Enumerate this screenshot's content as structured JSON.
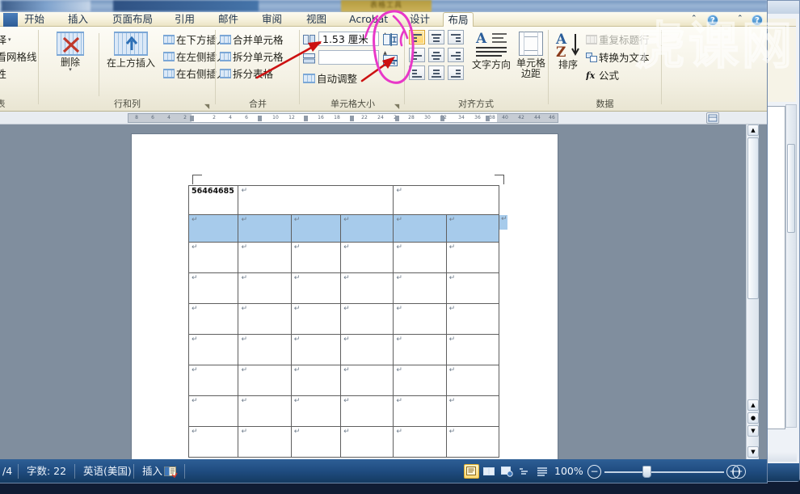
{
  "window": {
    "contextual_tab_header": "表格工具",
    "watermark": "虎课网"
  },
  "tabs": [
    {
      "label": "开始",
      "active": false
    },
    {
      "label": "插入",
      "active": false
    },
    {
      "label": "页面布局",
      "active": false
    },
    {
      "label": "引用",
      "active": false
    },
    {
      "label": "邮件",
      "active": false
    },
    {
      "label": "审阅",
      "active": false
    },
    {
      "label": "视图",
      "active": false
    },
    {
      "label": "Acrobat",
      "active": false
    },
    {
      "label": "设计",
      "active": false
    },
    {
      "label": "布局",
      "active": true
    }
  ],
  "ribbon": {
    "groups": [
      {
        "name": "表",
        "title": "表",
        "items": [
          {
            "label": "选择",
            "icon": "select-table-icon"
          },
          {
            "label": "查看网格线",
            "icon": "view-gridlines-icon"
          },
          {
            "label": "属性",
            "icon": "table-properties-icon"
          }
        ]
      },
      {
        "name": "行和列",
        "title": "行和列",
        "items": [
          {
            "label": "删除",
            "icon": "delete-table-icon"
          },
          {
            "label": "在上方插入",
            "icon": "insert-above-icon"
          },
          {
            "label": "在下方插入",
            "icon": "insert-below-icon"
          },
          {
            "label": "在左侧插入",
            "icon": "insert-left-icon"
          },
          {
            "label": "在右侧插入",
            "icon": "insert-right-icon"
          }
        ]
      },
      {
        "name": "合并",
        "title": "合并",
        "items": [
          {
            "label": "合并单元格",
            "icon": "merge-cells-icon"
          },
          {
            "label": "拆分单元格",
            "icon": "split-cells-icon"
          },
          {
            "label": "拆分表格",
            "icon": "split-table-icon"
          }
        ]
      },
      {
        "name": "单元格大小",
        "title": "单元格大小",
        "height_value": "1.53 厘米",
        "width_value": "",
        "items": [
          {
            "label": "自动调整",
            "icon": "autofit-icon"
          },
          {
            "label": "",
            "icon": "distribute-rows-icon"
          },
          {
            "label": "",
            "icon": "distribute-columns-icon"
          }
        ]
      },
      {
        "name": "对齐方式",
        "title": "对齐方式",
        "align_buttons": [
          "align-top-left",
          "align-top-center",
          "align-top-right",
          "align-middle-left",
          "align-middle-center",
          "align-middle-right",
          "align-bottom-left",
          "align-bottom-center",
          "align-bottom-right"
        ],
        "selected_align": "align-top-left",
        "items": [
          {
            "label": "文字方向",
            "icon": "text-direction-icon"
          },
          {
            "label": "单元格边距",
            "icon": "cell-margins-icon"
          }
        ]
      },
      {
        "name": "数据",
        "title": "数据",
        "items": [
          {
            "label": "排序",
            "icon": "sort-az-icon"
          },
          {
            "label": "重复标题行",
            "icon": "repeat-header-icon",
            "disabled": true
          },
          {
            "label": "转换为文本",
            "icon": "convert-to-text-icon"
          },
          {
            "label": "公式",
            "icon": "formula-fx-icon"
          }
        ]
      }
    ]
  },
  "ruler": {
    "ticks": [
      "8",
      "6",
      "4",
      "2",
      "2",
      "4",
      "6",
      "10",
      "12",
      "16",
      "18",
      "22",
      "24",
      "2",
      "28",
      "30",
      "32",
      "34",
      "36",
      "38",
      "40",
      "42",
      "44",
      "46",
      "4"
    ]
  },
  "document": {
    "table": {
      "columns": 6,
      "first_row": {
        "cells": [
          "56464685",
          "",
          ""
        ],
        "spans": [
          1,
          3,
          2
        ]
      },
      "paragraph_mark": "↵",
      "selected_row_index": 1,
      "body_rows": 8
    }
  },
  "statusbar": {
    "page_label": "/4",
    "word_count": "字数: 22",
    "language": "英语(美国)",
    "insert_mode": "插入",
    "proofing_icon": "proofing-errors-icon",
    "views": [
      {
        "name": "print-layout-view",
        "selected": true
      },
      {
        "name": "full-screen-reading-view",
        "selected": false
      },
      {
        "name": "web-layout-view",
        "selected": false
      },
      {
        "name": "outline-view",
        "selected": false
      },
      {
        "name": "draft-view",
        "selected": false
      }
    ],
    "zoom_level": "100%",
    "zoom_out_label": "−",
    "zoom_in_label": "+"
  },
  "colors": {
    "accent": "#1f4c80",
    "selection": "#a7cbeb",
    "annotation_arrow": "#cc1111",
    "annotation_circle": "#e838c8",
    "ribbon_bg": "#f4f1e4"
  }
}
